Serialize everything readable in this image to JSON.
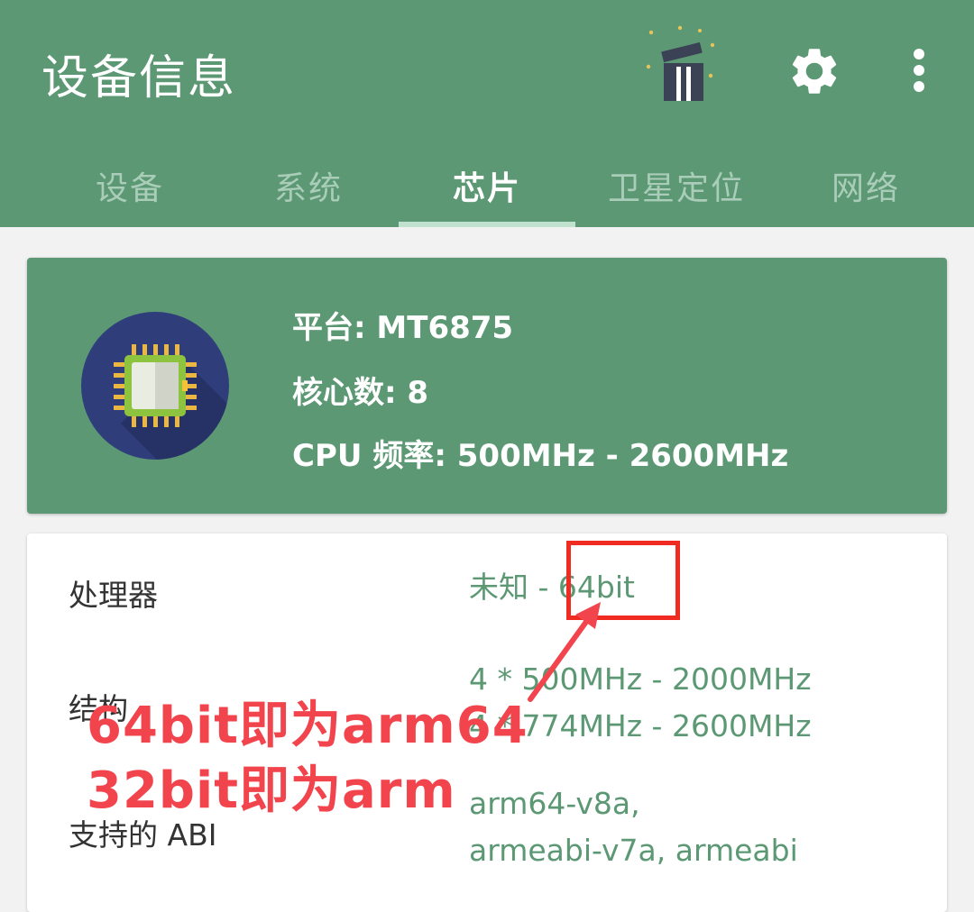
{
  "appbar": {
    "title": "设备信息",
    "icons": {
      "ad": "ad-clapper-icon",
      "settings": "gear-icon",
      "more": "more-vert-icon"
    },
    "colors": {
      "bar": "#5b9873",
      "tab_inactive": "#a9cdb8",
      "tab_indicator": "#bfe1cd"
    }
  },
  "tabs": [
    {
      "label": "设备",
      "active": false
    },
    {
      "label": "系统",
      "active": false
    },
    {
      "label": "芯片",
      "active": true
    },
    {
      "label": "卫星定位",
      "active": false
    },
    {
      "label": "网络",
      "active": false
    }
  ],
  "summary": {
    "icon": "cpu-chip-icon",
    "platform": "平台: MT6875",
    "cores": "核心数: 8",
    "frequency": "CPU 频率: 500MHz - 2600MHz"
  },
  "details": [
    {
      "label": "处理器",
      "values": [
        "未知 - 64bit"
      ]
    },
    {
      "label": "结构",
      "values": [
        "4 * 500MHz - 2000MHz",
        "4 * 774MHz - 2600MHz"
      ]
    },
    {
      "label": "支持的 ABI",
      "values": [
        "arm64-v8a,",
        "armeabi-v7a, armeabi"
      ]
    }
  ],
  "annotation": {
    "line1": "64bit即为arm64",
    "line2": "32bit即为arm",
    "color": "#f2444d",
    "box_color": "#ef2b22"
  }
}
